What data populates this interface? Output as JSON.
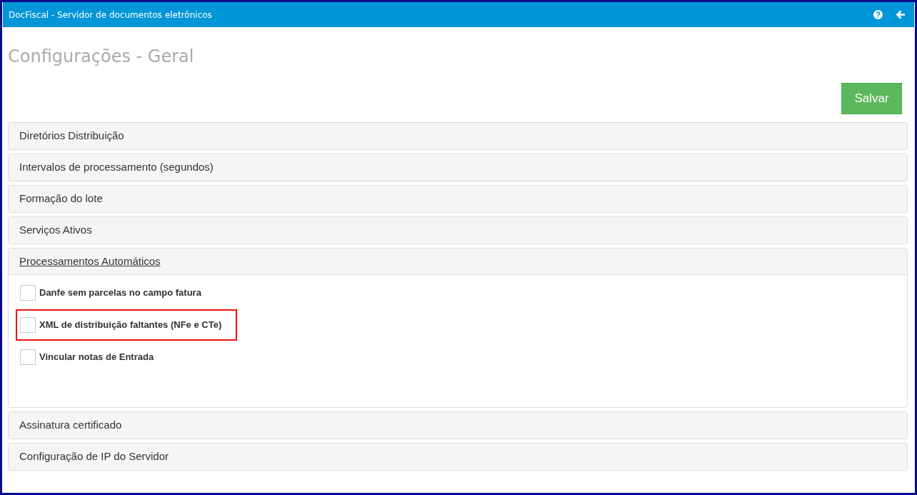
{
  "window": {
    "title": "DocFiscal - Servidor de documentos eletrônicos"
  },
  "page": {
    "title": "Configurações - Geral",
    "save_button": "Salvar"
  },
  "panels": [
    {
      "title": "Diretórios Distribuição",
      "expanded": false
    },
    {
      "title": "Intervalos de processamento (segundos)",
      "expanded": false
    },
    {
      "title": "Formação do lote",
      "expanded": false
    },
    {
      "title": "Serviços Ativos",
      "expanded": false
    },
    {
      "title": "Processamentos Automáticos",
      "expanded": true,
      "options": [
        {
          "label": "Danfe sem parcelas no campo fatura",
          "checked": false,
          "highlighted": false
        },
        {
          "label": "XML de distribuição faltantes (NFe e CTe)",
          "checked": false,
          "highlighted": true
        },
        {
          "label": "Vincular notas de Entrada",
          "checked": false,
          "highlighted": false
        }
      ]
    },
    {
      "title": "Assinatura certificado",
      "expanded": false
    },
    {
      "title": "Configuração de IP do Servidor",
      "expanded": false
    }
  ]
}
